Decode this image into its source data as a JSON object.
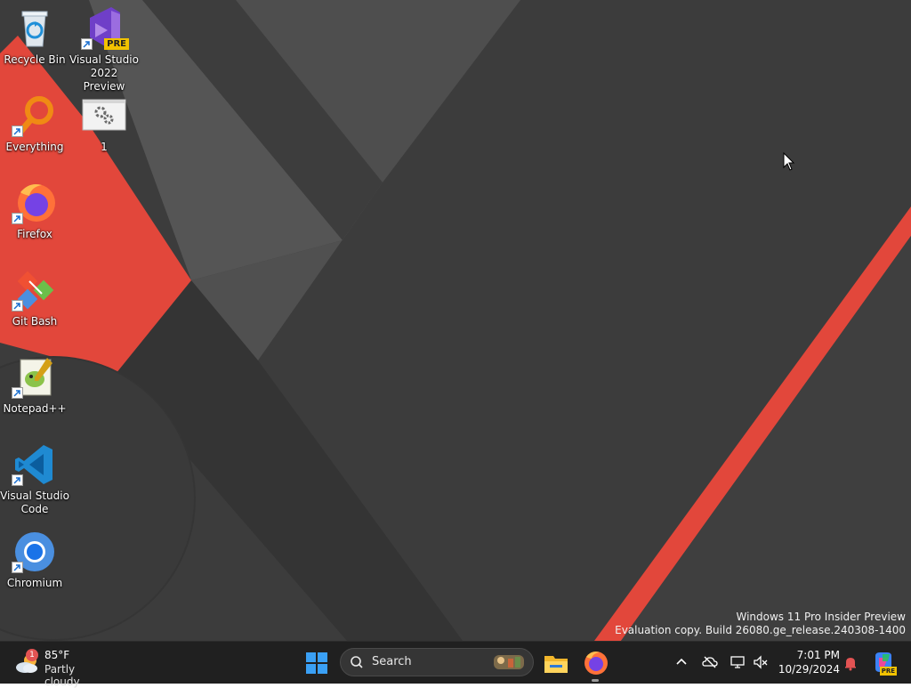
{
  "desktop": {
    "icons": [
      {
        "label": "Recycle Bin",
        "icon": "recycle-bin-icon",
        "shortcut": false
      },
      {
        "label": "Visual Studio\n2022 Preview",
        "icon": "visual-studio-preview-icon",
        "shortcut": true,
        "badge": "PRE"
      },
      {
        "label": "Everything",
        "icon": "everything-search-icon",
        "shortcut": true
      },
      {
        "label": "1",
        "icon": "settings-file-icon",
        "shortcut": false
      },
      {
        "label": "Firefox",
        "icon": "firefox-icon",
        "shortcut": true
      },
      {
        "label": "Git Bash",
        "icon": "git-bash-icon",
        "shortcut": true
      },
      {
        "label": "Notepad++",
        "icon": "notepad-plus-plus-icon",
        "shortcut": true
      },
      {
        "label": "Visual Studio\nCode",
        "icon": "vscode-icon",
        "shortcut": true
      },
      {
        "label": "Chromium",
        "icon": "chromium-icon",
        "shortcut": true
      }
    ],
    "watermark": {
      "line1": "Windows 11 Pro Insider Preview",
      "line2": "Evaluation copy. Build 26080.ge_release.240308-1400"
    },
    "wallpaper_colors": {
      "dark": "#3a3a3a",
      "mid": "#4a4a4a",
      "light": "#575757",
      "accent": "#e2473b"
    }
  },
  "taskbar": {
    "weather": {
      "temperature": "85°F",
      "condition": "Partly cloudy",
      "badge": "1"
    },
    "search": {
      "placeholder": "Search"
    },
    "pinned": [
      "start-icon",
      "file-explorer-icon",
      "firefox-icon"
    ],
    "tray": [
      "chevron-up-icon",
      "onedrive-offline-icon",
      "network-icon",
      "volume-muted-icon"
    ],
    "clock": {
      "time": "7:01 PM",
      "date": "10/29/2024"
    },
    "notifications_icon": "bell-icon",
    "copilot_badge": "PRE"
  }
}
